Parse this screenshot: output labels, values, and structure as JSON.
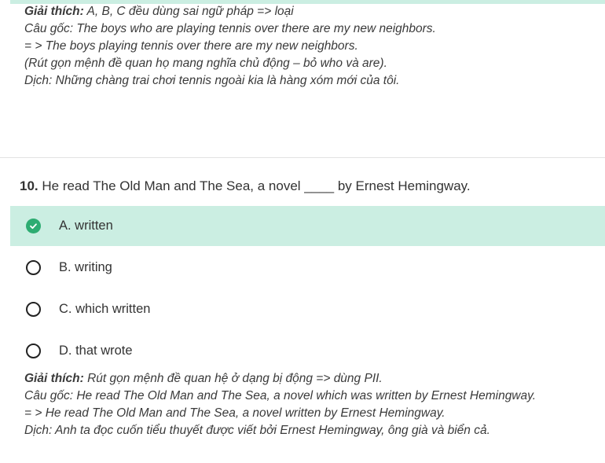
{
  "previous_explanation": {
    "label": "Giải thích:",
    "text": " A, B, C đều dùng sai ngữ pháp => loại",
    "lines": [
      "Câu gốc: The boys who are playing tennis over there are my new neighbors.",
      "= > The boys playing tennis over there are my new neighbors.",
      "(Rút gọn mệnh đề quan họ mang nghĩa chủ động – bỏ who và are).",
      "Dịch: Những chàng trai chơi tennis ngoài kia là hàng xóm mới của tôi."
    ]
  },
  "question": {
    "number": "10.",
    "text": " He read The Old Man and The Sea, a novel ____ by Ernest Hemingway."
  },
  "options": [
    {
      "label": "A. written",
      "state": "correct"
    },
    {
      "label": "B. writing",
      "state": "unselected"
    },
    {
      "label": "C. which written",
      "state": "unselected"
    },
    {
      "label": "D. that wrote",
      "state": "unselected"
    }
  ],
  "explanation": {
    "label": "Giải thích:",
    "text": " Rút gọn mệnh đề quan hệ ở dạng bị động => dùng PII.",
    "lines": [
      "Câu gốc: He read The Old Man and The Sea, a novel which was written by Ernest Hemingway.",
      "= > He read The Old Man and The Sea, a novel written by Ernest Hemingway.",
      "Dịch: Anh ta đọc cuốn tiểu thuyết được viết bởi Ernest Hemingway, ông già và biển cả."
    ]
  },
  "colors": {
    "correct_background": "#cbeee2",
    "check_green": "#2eac72"
  },
  "icons": {
    "correct": "check-circle-icon",
    "unselected": "radio-circle-icon"
  }
}
